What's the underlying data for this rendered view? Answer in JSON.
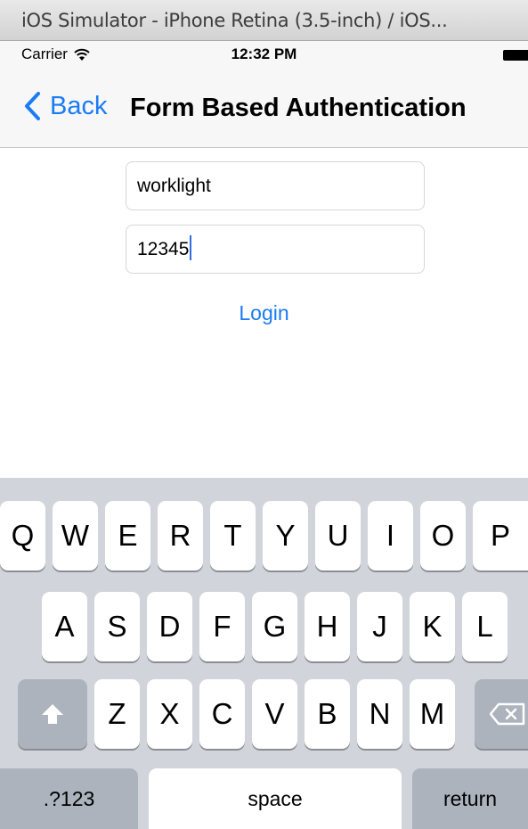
{
  "window": {
    "title": "iOS Simulator - iPhone Retina (3.5-inch) / iOS..."
  },
  "status_bar": {
    "carrier": "Carrier",
    "time": "12:32 PM",
    "icons": [
      "wifi-icon",
      "battery-icon"
    ]
  },
  "nav_bar": {
    "back_label": "Back",
    "title": "Form Based Authentication",
    "back_icon": "chevron-left-icon"
  },
  "form": {
    "username_value": "worklight",
    "password_value": "12345",
    "login_label": "Login"
  },
  "keyboard": {
    "row1": [
      "Q",
      "W",
      "E",
      "R",
      "T",
      "Y",
      "U",
      "I",
      "O",
      "P"
    ],
    "row2": [
      "A",
      "S",
      "D",
      "F",
      "G",
      "H",
      "J",
      "K",
      "L"
    ],
    "row3": [
      "Z",
      "X",
      "C",
      "V",
      "B",
      "N",
      "M"
    ],
    "numbers_label": ".?123",
    "space_label": "space",
    "return_label": "return",
    "shift_icon": "shift-arrow-icon",
    "delete_icon": "delete-backspace-icon"
  },
  "colors": {
    "accent": "#1a7cf4",
    "keyboard_bg": "#d1d5db",
    "special_key": "#acb3bd",
    "caret": "#2f6fe0"
  }
}
